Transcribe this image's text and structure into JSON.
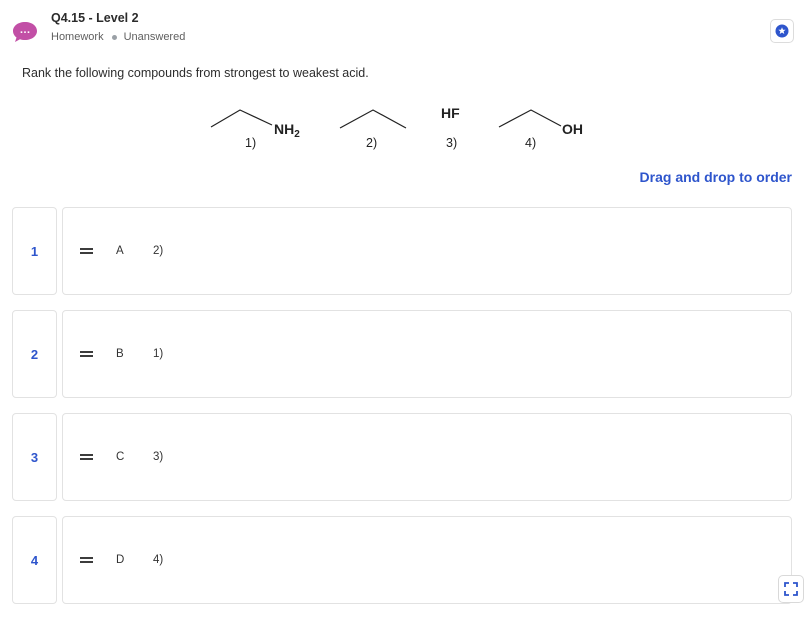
{
  "header": {
    "title": "Q4.15 - Level 2",
    "meta_type": "Homework",
    "meta_status": "Unanswered",
    "avatar_glyph": "…",
    "avatar_color": "#c24fa6"
  },
  "question": {
    "prompt": "Rank the following compounds from strongest to weakest acid."
  },
  "molecules": [
    {
      "label": "1)",
      "group_main": "NH",
      "group_sub": "2"
    },
    {
      "label": "2)",
      "group_main": "",
      "group_sub": ""
    },
    {
      "label": "3)",
      "group_main": "HF",
      "group_sub": ""
    },
    {
      "label": "4)",
      "group_main": "OH",
      "group_sub": ""
    }
  ],
  "instruction": "Drag and drop to order",
  "ranking": [
    {
      "rank": "1",
      "letter": "A",
      "choice": "2)"
    },
    {
      "rank": "2",
      "letter": "B",
      "choice": "1)"
    },
    {
      "rank": "3",
      "letter": "C",
      "choice": "3)"
    },
    {
      "rank": "4",
      "letter": "D",
      "choice": "4)"
    }
  ],
  "colors": {
    "accent": "#2e55cc",
    "border": "#e2e2e2"
  }
}
